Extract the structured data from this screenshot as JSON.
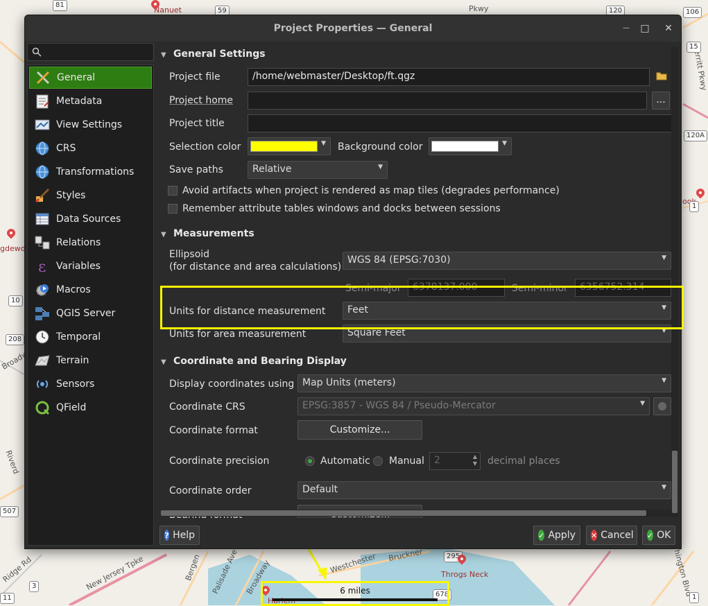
{
  "map": {
    "place_labels": [
      "Nanuet",
      "Broadway",
      "New Jersey Tpke",
      "Bergen",
      "Palisade Ave",
      "Broadway",
      "Westchester",
      "Bruckner",
      "Throgs Neck",
      "Ridge Rd",
      "Merritt Pkwy",
      "Pkwy",
      "gdewood",
      "ook",
      "Harlem",
      "Riverd",
      "hington Blvd",
      "Harl"
    ],
    "route_shields": [
      "81",
      "59",
      "120",
      "15",
      "120A",
      "1",
      "10",
      "208",
      "507",
      "295",
      "678",
      "3",
      "11",
      "106",
      "1"
    ],
    "scale": {
      "label": "6 miles"
    }
  },
  "dialog": {
    "title": "Project Properties — General",
    "window_buttons": {
      "minimize": "—",
      "maximize": "□",
      "close": "✕"
    },
    "search": {
      "value": "",
      "placeholder": ""
    },
    "sidebar": [
      {
        "label": "General",
        "icon": "general-tools-icon",
        "active": true
      },
      {
        "label": "Metadata",
        "icon": "metadata-icon"
      },
      {
        "label": "View Settings",
        "icon": "view-settings-icon"
      },
      {
        "label": "CRS",
        "icon": "crs-globe-icon"
      },
      {
        "label": "Transformations",
        "icon": "transformations-globe-icon"
      },
      {
        "label": "Styles",
        "icon": "styles-brush-icon"
      },
      {
        "label": "Data Sources",
        "icon": "data-sources-table-icon"
      },
      {
        "label": "Relations",
        "icon": "relations-icon"
      },
      {
        "label": "Variables",
        "icon": "variables-epsilon-icon"
      },
      {
        "label": "Macros",
        "icon": "macros-gear-icon"
      },
      {
        "label": "QGIS Server",
        "icon": "qgis-server-icon"
      },
      {
        "label": "Temporal",
        "icon": "temporal-clock-icon"
      },
      {
        "label": "Terrain",
        "icon": "terrain-map-icon"
      },
      {
        "label": "Sensors",
        "icon": "sensors-icon"
      },
      {
        "label": "QField",
        "icon": "qfield-icon"
      }
    ],
    "general": {
      "heading": "General Settings",
      "project_file_label": "Project file",
      "project_file_value": "/home/webmaster/Desktop/ft.qgz",
      "project_home_label": "Project home",
      "project_home_value": "",
      "project_home_browse": "...",
      "project_title_label": "Project title",
      "project_title_value": "",
      "selection_color_label": "Selection color",
      "selection_color": "#ffff00",
      "background_color_label": "Background color",
      "background_color": "#ffffff",
      "save_paths_label": "Save paths",
      "save_paths_value": "Relative",
      "avoid_artifacts_label": "Avoid artifacts when project is rendered as map tiles (degrades performance)",
      "remember_tables_label": "Remember attribute tables windows and docks between sessions"
    },
    "measurements": {
      "heading": "Measurements",
      "ellipsoid_label_line1": "Ellipsoid",
      "ellipsoid_label_line2": "(for distance and area calculations)",
      "ellipsoid_value": "WGS 84 (EPSG:7030)",
      "semi_major_label": "Semi-major",
      "semi_major_value": "6378137.000",
      "semi_minor_label": "Semi-minor",
      "semi_minor_value": "6356752.314",
      "distance_units_label": "Units for distance measurement",
      "distance_units_value": "Feet",
      "area_units_label": "Units for area measurement",
      "area_units_value": "Square Feet"
    },
    "coordinates": {
      "heading": "Coordinate and Bearing Display",
      "display_using_label": "Display coordinates using",
      "display_using_value": "Map Units (meters)",
      "crs_label": "Coordinate CRS",
      "crs_value": "EPSG:3857 - WGS 84 / Pseudo-Mercator",
      "format_label": "Coordinate format",
      "format_button": "Customize...",
      "precision_label": "Coordinate precision",
      "precision_automatic": "Automatic",
      "precision_manual": "Manual",
      "precision_value": "2",
      "precision_suffix": "decimal places",
      "order_label": "Coordinate order",
      "order_value": "Default",
      "bearing_label": "Bearing format",
      "bearing_button": "Customize..."
    },
    "buttons": {
      "help": "Help",
      "apply": "Apply",
      "cancel": "Cancel",
      "ok": "OK"
    },
    "colors": {
      "accent_green": "#2e7d12",
      "annotation_yellow": "#f7f700"
    }
  }
}
